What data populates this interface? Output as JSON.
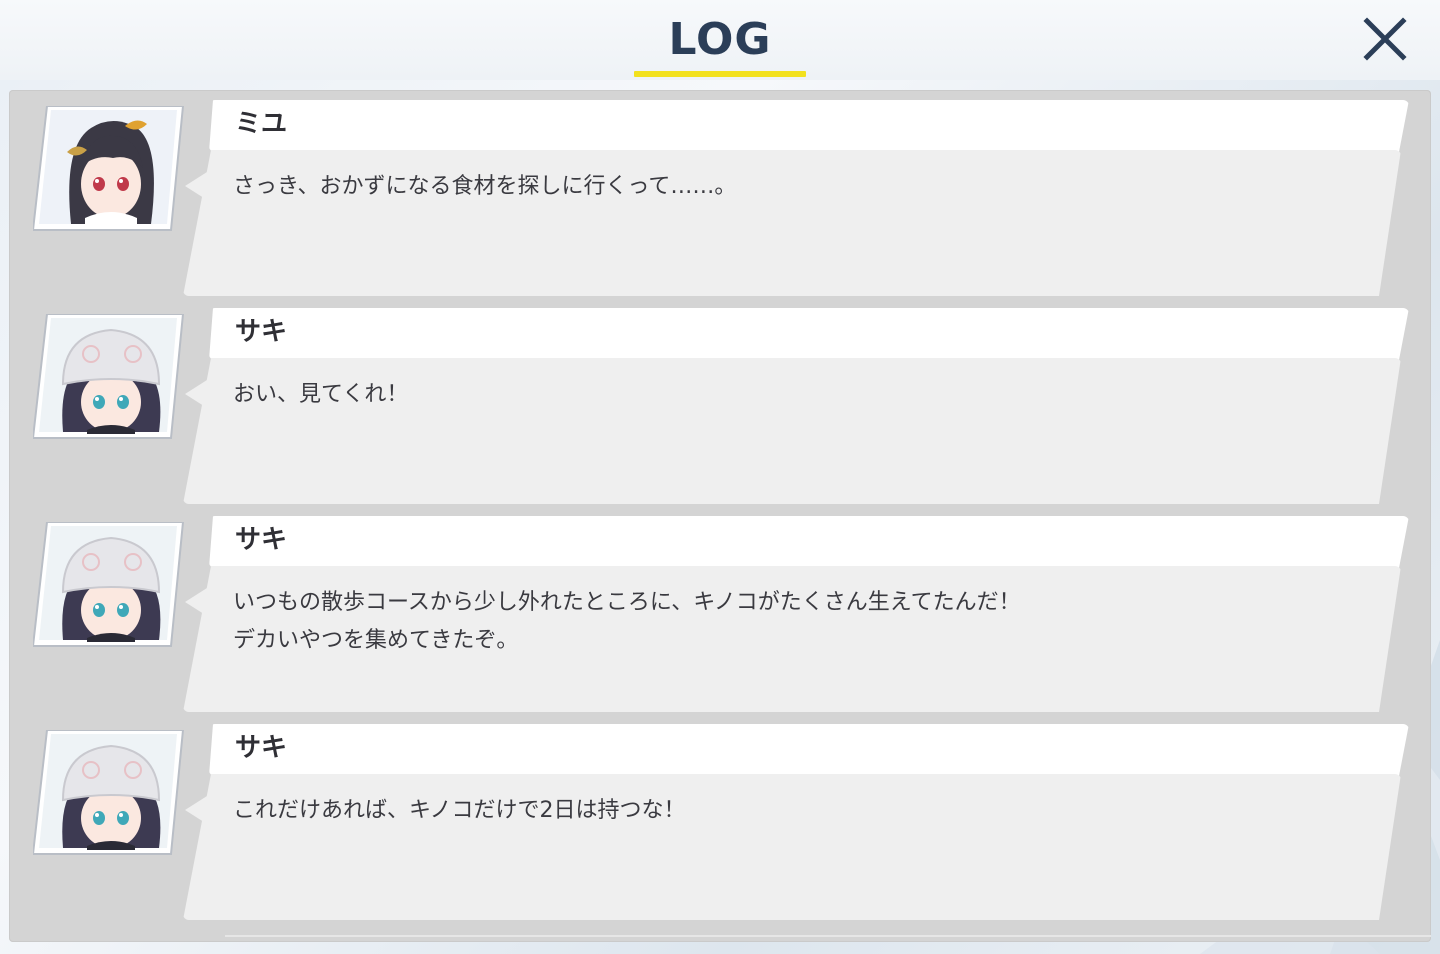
{
  "header": {
    "title": "LOG",
    "accent_color": "#f2e11e",
    "title_color": "#2b3e58"
  },
  "close_button": {
    "icon": "close-icon"
  },
  "log_entries": [
    {
      "speaker": "ミユ",
      "avatar_icon": "character-portrait-miyu",
      "message": "さっき、おかずになる食材を探しに行くって……。"
    },
    {
      "speaker": "サキ",
      "avatar_icon": "character-portrait-saki",
      "message": "おい、見てくれ！"
    },
    {
      "speaker": "サキ",
      "avatar_icon": "character-portrait-saki",
      "message": "いつもの散歩コースから少し外れたところに、キノコがたくさん生えてたんだ！\nデカいやつを集めてきたぞ。"
    },
    {
      "speaker": "サキ",
      "avatar_icon": "character-portrait-saki",
      "message": "これだけあれば、キノコだけで2日は持つな！"
    }
  ]
}
